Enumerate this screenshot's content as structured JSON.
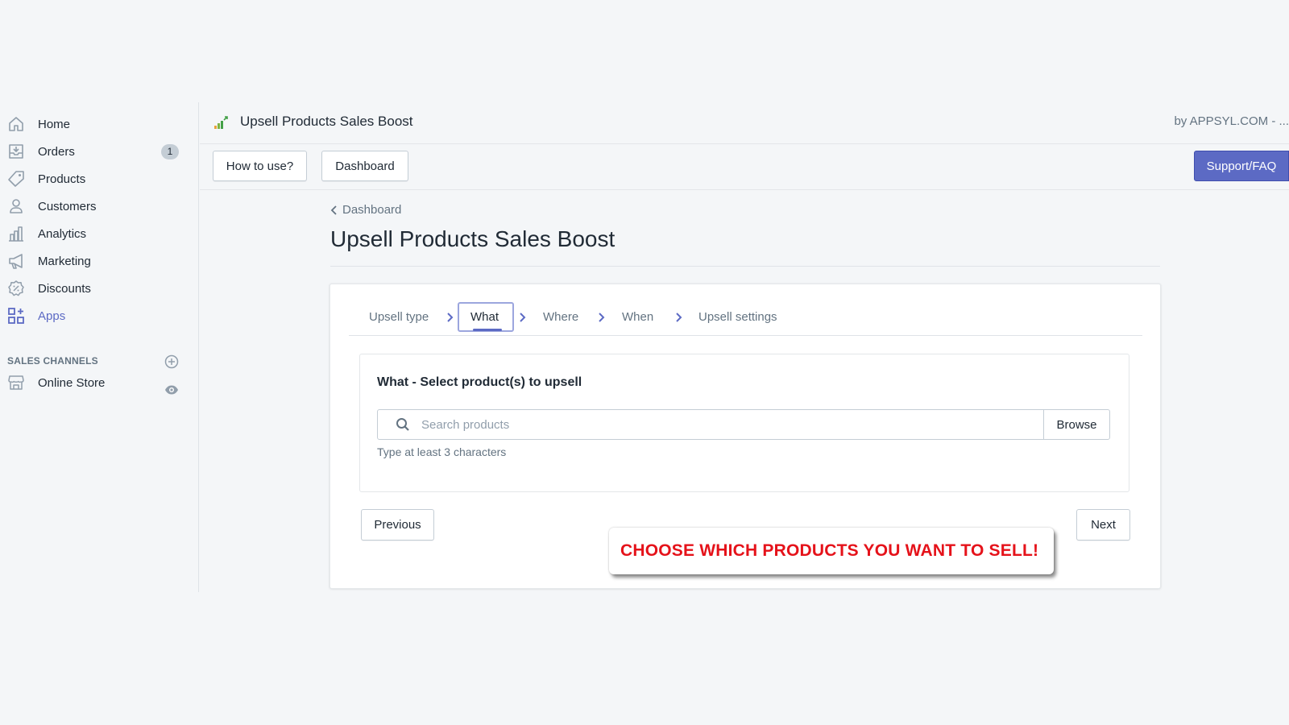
{
  "sidebar": {
    "items": [
      {
        "label": "Home",
        "icon": "home-icon"
      },
      {
        "label": "Orders",
        "icon": "orders-icon",
        "badge": "1"
      },
      {
        "label": "Products",
        "icon": "tag-icon"
      },
      {
        "label": "Customers",
        "icon": "person-icon"
      },
      {
        "label": "Analytics",
        "icon": "bar-chart-icon"
      },
      {
        "label": "Marketing",
        "icon": "megaphone-icon"
      },
      {
        "label": "Discounts",
        "icon": "discount-icon"
      },
      {
        "label": "Apps",
        "icon": "apps-icon",
        "active": true
      }
    ],
    "sales_channels_title": "SALES CHANNELS",
    "online_store": "Online Store"
  },
  "app": {
    "title": "Upsell Products Sales Boost",
    "byline": "by APPSYL.COM - ..."
  },
  "toolbar": {
    "how_to_use": "How to use?",
    "dashboard": "Dashboard",
    "support": "Support/FAQ"
  },
  "page": {
    "breadcrumb": "Dashboard",
    "title": "Upsell Products Sales Boost"
  },
  "steps": {
    "upsell_type": "Upsell type",
    "what": "What",
    "where": "Where",
    "when": "When",
    "upsell_settings": "Upsell settings",
    "active_step": "What"
  },
  "what_section": {
    "title": "What - Select product(s) to upsell",
    "search_placeholder": "Search products",
    "browse": "Browse",
    "help": "Type at least 3 characters"
  },
  "nav_buttons": {
    "previous": "Previous",
    "next": "Next"
  },
  "callout": "CHOOSE WHICH PRODUCTS YOU WANT TO SELL!",
  "colors": {
    "accent": "#5c6ac4",
    "callout_text": "#e5121a",
    "background": "#f4f6f8"
  }
}
